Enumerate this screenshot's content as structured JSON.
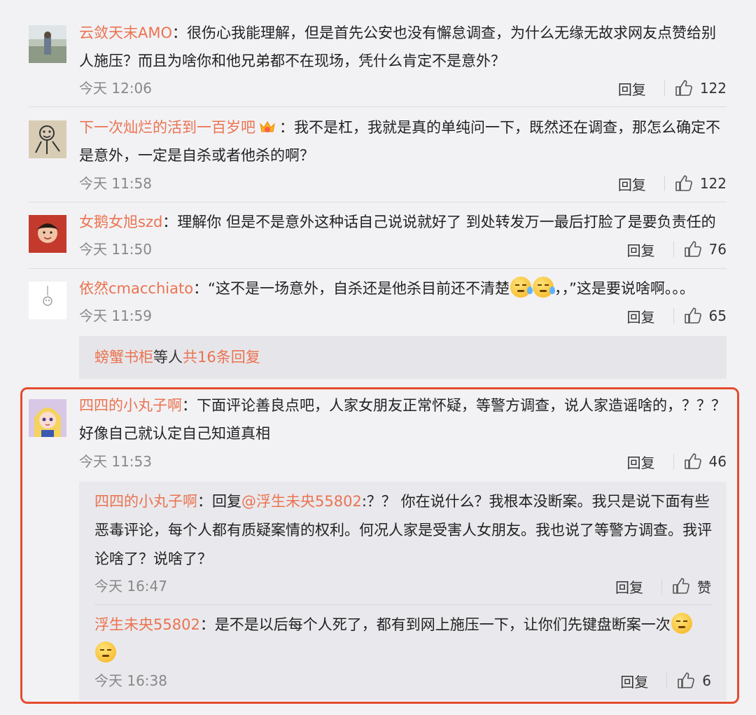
{
  "comments": [
    {
      "username": "云敛天末AMO",
      "text": "：很伤心我能理解，但是首先公安也没有懈怠调查，为什么无缘无故求网友点赞给别人施压？而且为啥你和他兄弟都不在现场，凭什么肯定不是意外？",
      "time": "今天 12:06",
      "reply_label": "回复",
      "likes": "122",
      "avatar": "person-outdoors-avatar"
    },
    {
      "username": "下一次灿烂的活到一百岁吧",
      "text": "：我不是杠，我就是真的单纯问一下，既然还在调查，那怎么确定不是意外，一定是自杀或者他杀的啊？",
      "time": "今天 11:58",
      "reply_label": "回复",
      "likes": "122",
      "avatar": "doodle-avatar",
      "badge": "crown-badge"
    },
    {
      "username": "女鹅女旭szd",
      "text": "：理解你 但是不是意外这种话自己说说就好了 到处转发万一最后打脸了是要负责任的",
      "time": "今天 11:50",
      "reply_label": "回复",
      "likes": "76",
      "avatar": "portrait-avatar"
    },
    {
      "username": "依然cmacchiato",
      "text_before": "：“这不是一场意外，自杀还是他杀目前还不清楚",
      "text_after": "，，”这是要说啥啊。。。",
      "time": "今天 11:59",
      "reply_label": "回复",
      "likes": "65",
      "avatar": "sketch-avatar"
    }
  ],
  "more_replies": {
    "user": "螃蟹书柜",
    "middle": " 等人 ",
    "count_text": "共16条回复"
  },
  "highlighted": {
    "username": "四四的小丸子啊",
    "text": "：下面评论善良点吧，人家女朋友正常怀疑，等警方调查，说人家造谣啥的，？？？ 好像自己就认定自己知道真相",
    "time": "今天 11:53",
    "reply_label": "回复",
    "likes": "46",
    "replies": [
      {
        "username": "四四的小丸子啊",
        "prefix": "：回复",
        "mention": "@浮生未央55802",
        "text": ":？？ 你在说什么？我根本没断案。我只是说下面有些恶毒评论，每个人都有质疑案情的权利。何况人家是受害人女朋友。我也说了等警方调查。我评论啥了？说啥了？",
        "time": "今天 16:47",
        "reply_label": "回复",
        "likes": "赞"
      },
      {
        "username": "浮生未央55802",
        "text": "：是不是以后每个人死了，都有到网上施压一下，让你们先键盘断案一次",
        "time": "今天 16:38",
        "reply_label": "回复",
        "likes": "6"
      }
    ]
  },
  "colors": {
    "username": "#eb7350",
    "highlight_border": "#e44c2f",
    "background": "#f2f2f5"
  }
}
